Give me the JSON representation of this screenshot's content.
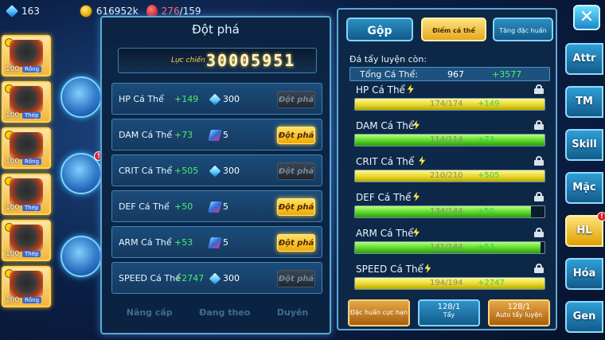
{
  "resources": {
    "gems": "163",
    "coins": "616952k",
    "stamina_current": "276",
    "stamina_max": "/159"
  },
  "roster": [
    {
      "level": "100",
      "type": "Rồng"
    },
    {
      "level": "100",
      "type": "Thép"
    },
    {
      "level": "100",
      "type": "Rồng"
    },
    {
      "level": "100",
      "type": "Thép"
    },
    {
      "level": "100",
      "type": "Thép"
    },
    {
      "level": "100",
      "type": "Rồng"
    }
  ],
  "breakthrough": {
    "title": "Đột phá",
    "power_label": "Lực chiến",
    "power_value": "30005951",
    "rows": [
      {
        "name": "HP Cá Thể",
        "bonus": "+149",
        "cost_icon": "diamond-icon",
        "cost": "300",
        "button": "Đột phá",
        "enabled": false
      },
      {
        "name": "DAM Cá Thể",
        "bonus": "+73",
        "cost_icon": "scroll-icon",
        "cost": "5",
        "button": "Đột phá",
        "enabled": true
      },
      {
        "name": "CRIT Cá Thể",
        "bonus": "+505",
        "cost_icon": "diamond-icon",
        "cost": "300",
        "button": "Đột phá",
        "enabled": false
      },
      {
        "name": "DEF Cá Thể",
        "bonus": "+50",
        "cost_icon": "scroll-icon",
        "cost": "5",
        "button": "Đột phá",
        "enabled": true
      },
      {
        "name": "ARM Cá Thể",
        "bonus": "+53",
        "cost_icon": "scroll-icon",
        "cost": "5",
        "button": "Đột phá",
        "enabled": true
      },
      {
        "name": "SPEED Cá Thể",
        "bonus": "+2747",
        "cost_icon": "diamond-icon",
        "cost": "300",
        "button": "Đột phá",
        "enabled": false
      }
    ],
    "bottom_tabs": [
      "Nâng cấp",
      "Đang theo",
      "Duyên"
    ]
  },
  "detail": {
    "tabs": {
      "merge": "Gộp",
      "points": "Điểm cá thể",
      "special": "Tăng đặc huấn"
    },
    "remain_label": "Đá tẩy luyện còn:",
    "total_label": "Tổng Cá Thể:",
    "total_value": "967",
    "total_bonus": "+3577",
    "bars": [
      {
        "name": "HP Cá Thể",
        "value": "174/174",
        "bonus": "+149",
        "fill": 1.0,
        "bonus_color": "yellow"
      },
      {
        "name": "DAM Cá Thể",
        "value": "114/114",
        "bonus": "+73",
        "fill": 1.0,
        "bonus_color": "green"
      },
      {
        "name": "CRIT Cá Thể",
        "value": "210/210",
        "bonus": "+505",
        "fill": 1.0,
        "bonus_color": "yellow"
      },
      {
        "name": "DEF Cá Thể",
        "value": "134/144",
        "bonus": "+50",
        "fill": 0.93,
        "bonus_color": "green"
      },
      {
        "name": "ARM Cá Thể",
        "value": "141/144",
        "bonus": "+53",
        "fill": 0.98,
        "bonus_color": "green"
      },
      {
        "name": "SPEED Cá Thể",
        "value": "194/194",
        "bonus": "+2747",
        "fill": 1.0,
        "bonus_color": "yellow"
      }
    ],
    "buttons": {
      "special_label": "Đặc huấn cực hạn",
      "wash_count": "128/1",
      "wash_label": "Tẩy",
      "auto_count": "128/1",
      "auto_label": "Auto tẩy luyện"
    }
  },
  "side_nav": [
    "Attr",
    "TM",
    "Skill",
    "Mặc",
    "HL",
    "Hóa",
    "Gen"
  ],
  "side_nav_active": "HL",
  "colors": {
    "accent_blue": "#2f9fd6",
    "gold": "#e0a000",
    "bonus_green": "#4cf06a"
  }
}
